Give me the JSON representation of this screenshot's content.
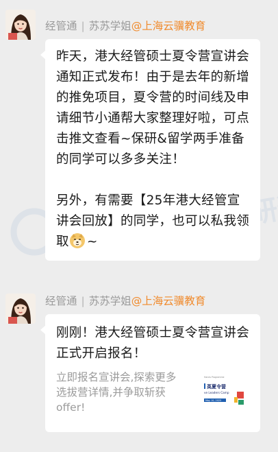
{
  "messages": [
    {
      "sender": {
        "name": "经管通",
        "separator": "|",
        "nickname": "苏苏学姐",
        "org": "@上海云骥教育"
      },
      "paragraphs": [
        "昨天，港大经管硕士夏令营宣讲会通知正式发布！由于是去年的新增的推免项目，夏令营的时间线及申请细节小通帮大家整理好啦，可点击推文查看~保研&留学两手准备的同学可以多多关注！",
        "另外，有需要【25年港大经管宣讲会回放】的同学，也可以私我领取"
      ],
      "emoji_name": "doge-emoji",
      "tail": "~"
    },
    {
      "sender": {
        "name": "经管通",
        "separator": "|",
        "nickname": "苏苏学姐",
        "org": "@上海云骥教育"
      },
      "card": {
        "title": "刚刚！港大经管硕士夏令营宣讲会正式开启报名！",
        "description": "立即报名宣讲会,探索更多选拔营详情,并争取斩获offer!",
        "thumbnail": {
          "badge": "英夏令营",
          "small_top": "Hanes Programme",
          "caption": "ve Leaders Camp",
          "date": "May 10, 2025"
        }
      }
    }
  ],
  "watermark": {
    "text": "有年专注经管保研通"
  },
  "colors": {
    "accent": "#f08a2c",
    "background": "#ededed",
    "bubble": "#ffffff"
  }
}
